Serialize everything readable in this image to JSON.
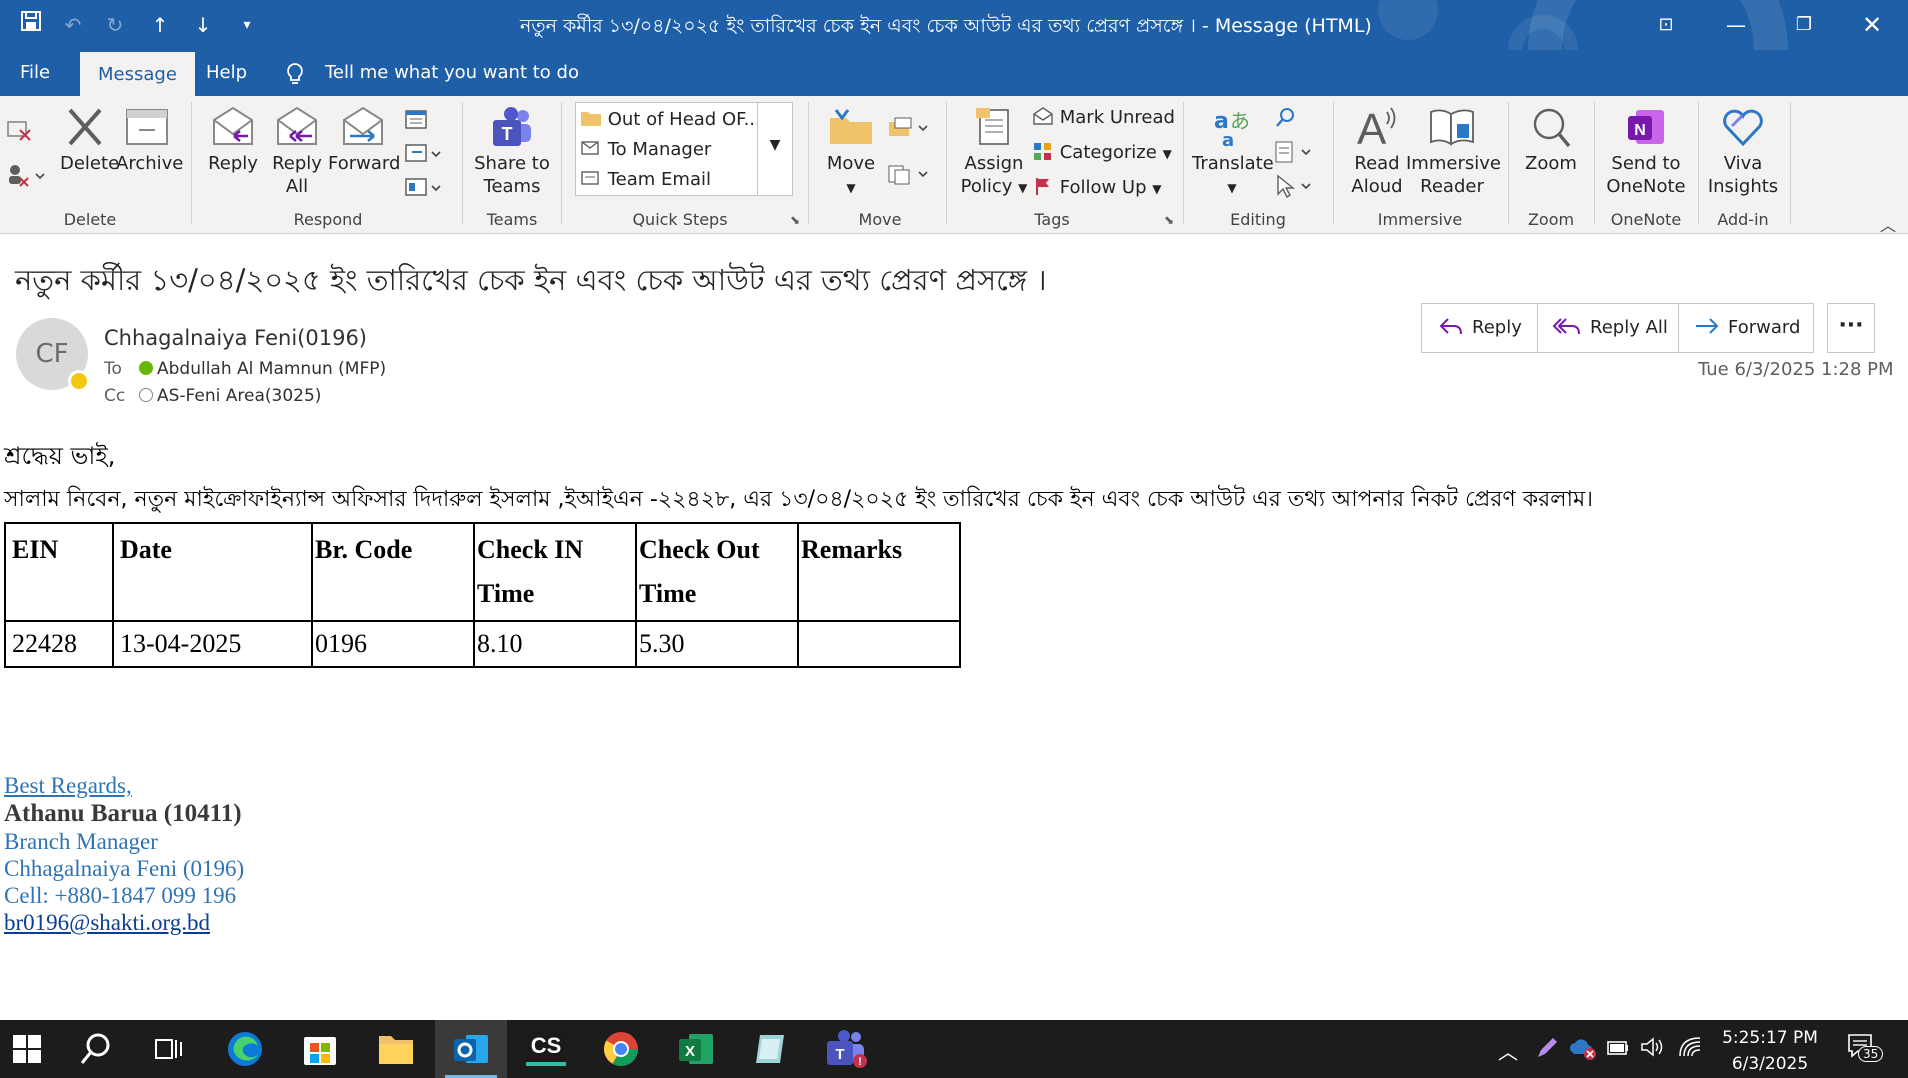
{
  "titlebar": {
    "title": "নতুন কর্মীর ১৩/০৪/২০২৫ ইং তারিখের চেক ইন এবং চেক আউট এর তথ্য প্রেরণ প্রসঙ্গে । - Message (HTML)"
  },
  "menu": {
    "tabs": [
      "File",
      "Message",
      "Help"
    ],
    "tellme": "Tell me what you want to do"
  },
  "ribbon": {
    "delete_group": {
      "label": "Delete",
      "delete": "Delete",
      "archive": "Archive"
    },
    "respond_group": {
      "label": "Respond",
      "reply": "Reply",
      "reply_all_1": "Reply",
      "reply_all_2": "All",
      "forward": "Forward"
    },
    "teams_group": {
      "label": "Teams",
      "share_1": "Share to",
      "share_2": "Teams"
    },
    "quicksteps_group": {
      "label": "Quick Steps",
      "items": [
        "Out of Head OF...",
        "To Manager",
        "Team Email"
      ]
    },
    "move_group": {
      "label": "Move",
      "move": "Move"
    },
    "tags_group": {
      "label": "Tags",
      "assign_1": "Assign",
      "assign_2": "Policy",
      "mark_unread": "Mark Unread",
      "categorize": "Categorize",
      "follow_up": "Follow Up"
    },
    "editing_group": {
      "label": "Editing",
      "translate": "Translate"
    },
    "immersive_group": {
      "label": "Immersive",
      "read_1": "Read",
      "read_2": "Aloud",
      "reader_1": "Immersive",
      "reader_2": "Reader"
    },
    "zoom_group": {
      "label": "Zoom",
      "zoom": "Zoom"
    },
    "onenote_group": {
      "label": "OneNote",
      "send_1": "Send to",
      "send_2": "OneNote"
    },
    "addin_group": {
      "label": "Add-in",
      "viva_1": "Viva",
      "viva_2": "Insights"
    }
  },
  "message": {
    "subject": "নতুন কর্মীর ১৩/০৪/২০২৫ ইং তারিখের চেক ইন এবং চেক আউট এর তথ্য প্রেরণ প্রসঙ্গে ।",
    "avatar_initials": "CF",
    "sender": "Chhagalnaiya Feni(0196)",
    "to_label": "To",
    "to": "Abdullah Al Mamnun (MFP)",
    "cc_label": "Cc",
    "cc": "AS-Feni Area(3025)",
    "actions": {
      "reply": "Reply",
      "reply_all": "Reply All",
      "forward": "Forward"
    },
    "date": "Tue 6/3/2025 1:28 PM"
  },
  "body": {
    "greeting": "শ্রদ্ধেয় ভাই,",
    "text": "সালাম নিবেন, নতুন মাইক্রোফাইন্যান্স অফিসার দিদারুল ইসলাম ,ইআইএন -২২৪২৮, এর ১৩/০৪/২০২৫ ইং তারিখের চেক ইন এবং চেক আউট এর তথ্য আপনার নিকট প্রেরণ করলাম।",
    "table": {
      "headers": [
        "EIN",
        "Date",
        "Br. Code",
        "Check IN Time",
        "Check Out Time",
        "Remarks"
      ],
      "rows": [
        [
          "22428",
          "13-04-2025",
          "0196",
          "8.10",
          "5.30",
          ""
        ]
      ]
    },
    "signature": {
      "regards": "Best Regards,",
      "name": "Athanu Barua (10411)",
      "title": "Branch Manager",
      "branch": "Chhagalnaiya Feni (0196)",
      "cell": "Cell: +880-1847 099 196",
      "email": "br0196@shakti.org.bd"
    }
  },
  "taskbar": {
    "time": "5:25:17 PM",
    "date": "6/3/2025",
    "notifications": "35"
  },
  "colors": {
    "accent": "#1f5fa8",
    "ribbon": "#f3f2f1",
    "link": "#2e74b5",
    "taskbar": "#1c1c1c"
  }
}
